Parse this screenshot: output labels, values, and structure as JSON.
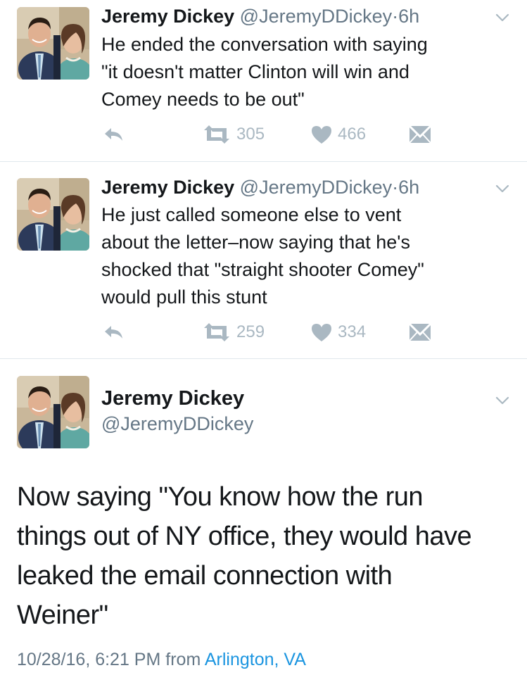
{
  "tweets": [
    {
      "name": "Jeremy Dickey",
      "handle": "@JeremyDDickey",
      "dot": "·",
      "time": "6h",
      "lines": [
        "He ended the conversation with saying",
        "\"it doesn't matter Clinton will win and",
        "Comey needs to be out\""
      ],
      "retweets": "305",
      "likes": "466"
    },
    {
      "name": "Jeremy Dickey",
      "handle": "@JeremyDDickey",
      "dot": "·",
      "time": "6h",
      "lines": [
        "He just called someone else to vent",
        "about the letter–now saying that he's",
        "shocked that \"straight shooter Comey\"",
        "would pull this stunt"
      ],
      "retweets": "259",
      "likes": "334"
    }
  ],
  "focused": {
    "name": "Jeremy Dickey",
    "handle": "@JeremyDDickey",
    "lines": [
      "Now saying \"You know how the run",
      "things out of NY office, they would have",
      "leaked the email connection with",
      "Weiner\""
    ],
    "timestamp": "10/28/16, 6:21 PM",
    "from": "from",
    "location": "Arlington, VA"
  },
  "colors": {
    "accent": "#1b95e0",
    "muted": "#657786",
    "icon": "#aab8c2",
    "divider": "#e1e8ed"
  },
  "icons": [
    "reply-icon",
    "retweet-icon",
    "heart-icon",
    "message-icon",
    "chevron-down-icon",
    "avatar"
  ]
}
